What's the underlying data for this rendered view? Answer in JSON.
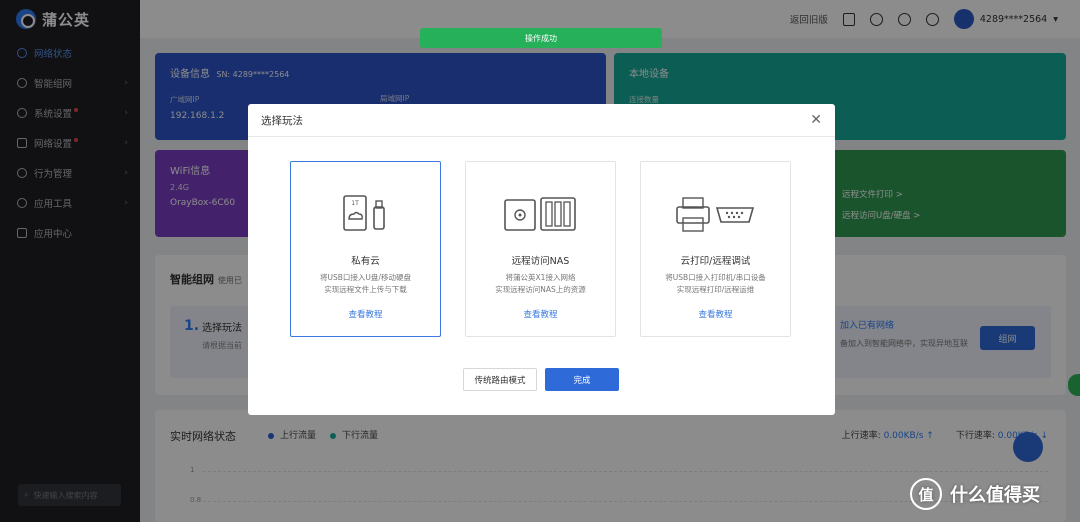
{
  "brand": {
    "name": "蒲公英",
    "accent": "#2f7cf6"
  },
  "sidebar": {
    "items": [
      {
        "label": "网络状态",
        "icon": "globe-icon",
        "active": true
      },
      {
        "label": "智能组网",
        "icon": "network-icon"
      },
      {
        "label": "系统设置",
        "icon": "settings-icon",
        "badge": true
      },
      {
        "label": "网络设置",
        "icon": "list-icon",
        "badge": true
      },
      {
        "label": "行为管理",
        "icon": "shield-icon"
      },
      {
        "label": "应用工具",
        "icon": "tools-icon"
      },
      {
        "label": "应用中心",
        "icon": "grid-icon"
      }
    ],
    "search_placeholder": "快速输入搜索内容"
  },
  "topbar": {
    "back_link": "返回旧版",
    "user": "4289****2564"
  },
  "toast": "操作成功",
  "cards": {
    "device": {
      "title": "设备信息",
      "sn": "SN:  4289****2564",
      "wan_label": "广域网IP",
      "wan_value": "192.168.1.2",
      "lan_label": "局域网IP"
    },
    "local": {
      "title": "本地设备",
      "sub": "连接数量"
    },
    "wifi": {
      "title": "WiFi信息",
      "band": "2.4G",
      "ssid": "OrayBox-6C60"
    },
    "remote": {
      "link1": "远程文件打印 >",
      "link2": "远程访问U盘/硬盘 >"
    }
  },
  "mesh": {
    "title": "智能组网",
    "subtitle": "使用已",
    "step": "选择玩法",
    "step_num": "1.",
    "hint": "请根据当前",
    "join_link": "加入已有网络",
    "join_hint": "备加入到智能网络中，实现异地互联",
    "join_btn": "组网"
  },
  "network": {
    "title": "实时网络状态",
    "legend_up": "上行流量",
    "legend_down": "下行流量",
    "up_label": "上行速率:",
    "up_value": "0.00KB/s ↑",
    "down_label": "下行速率:",
    "down_value": "0.00KB/s ↓",
    "ticks": [
      "1",
      "0.8"
    ],
    "up_color": "#2f5fd1",
    "down_color": "#17a99a"
  },
  "dialog": {
    "title": "选择玩法",
    "options": [
      {
        "name": "私有云",
        "desc1": "将USB口接入U盘/移动硬盘",
        "desc2": "实现远程文件上传与下载",
        "link": "查看教程",
        "icon": "cloud-drive-icon",
        "chip": "1T"
      },
      {
        "name": "远程访问NAS",
        "desc1": "将蒲公英X1接入网络",
        "desc2": "实现远程访问NAS上的资源",
        "link": "查看教程",
        "icon": "nas-icon"
      },
      {
        "name": "云打印/远程调试",
        "desc1": "将USB口接入打印机/串口设备",
        "desc2": "实现远程打印/远程运维",
        "link": "查看教程",
        "icon": "printer-icon"
      }
    ],
    "btn_legacy": "传统路由模式",
    "btn_done": "完成"
  },
  "watermark": {
    "badge": "值",
    "text": "什么值得买"
  }
}
